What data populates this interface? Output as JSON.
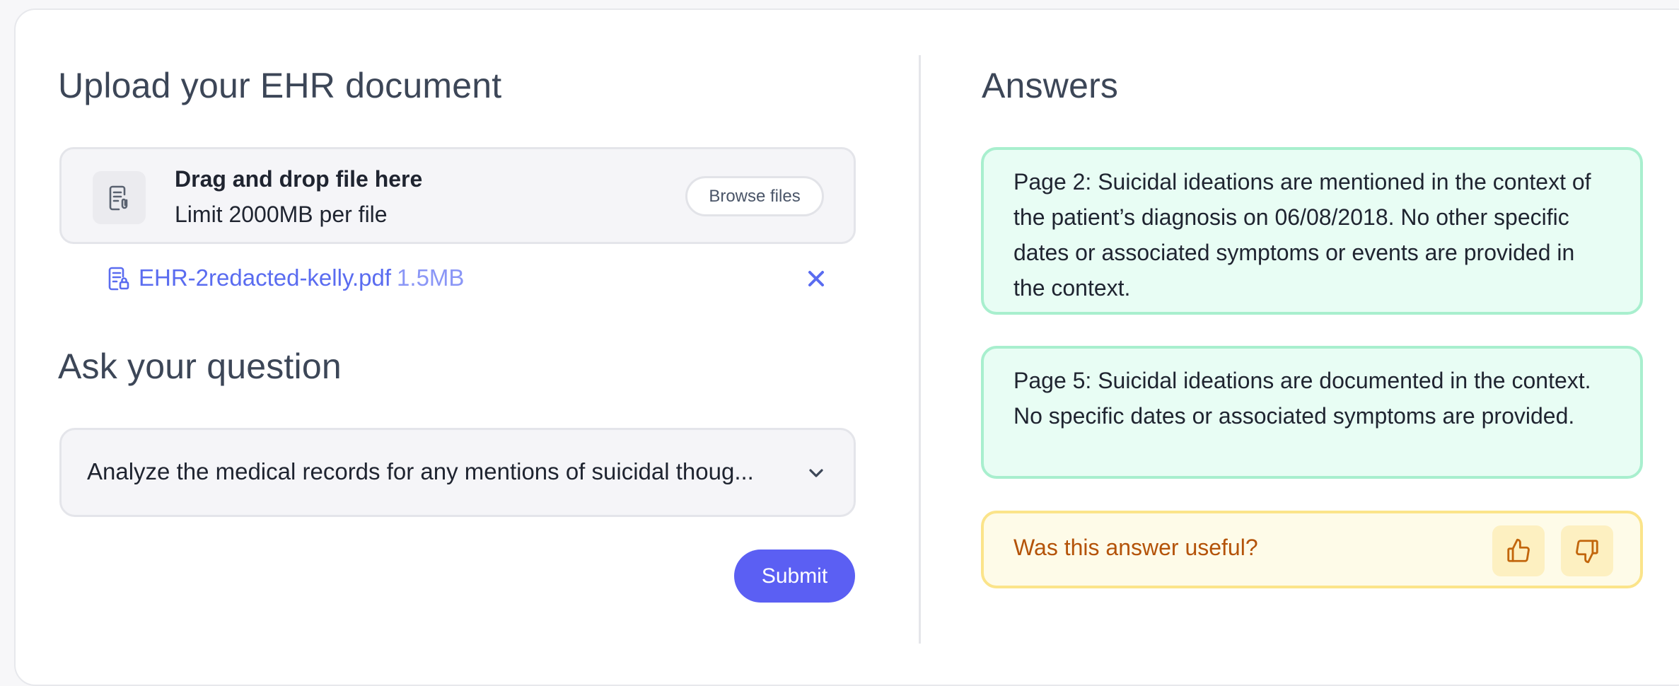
{
  "upload": {
    "heading": "Upload your EHR document",
    "dropzone_title": "Drag and drop file here",
    "dropzone_limit": "Limit 2000MB per file",
    "browse_label": "Browse files",
    "file_name": "EHR-2redacted-kelly.pdf",
    "file_size": "1.5MB"
  },
  "question": {
    "heading": "Ask your question",
    "selected": "Analyze the medical records for any mentions of suicidal thoug...",
    "submit_label": "Submit"
  },
  "answers": {
    "heading": "Answers",
    "items": [
      "Page 2: Suicidal ideations are mentioned in the context of the patient’s diagnosis on 06/08/2018. No other specific dates or associated symptoms or events are provided in the context.",
      "Page 5: Suicidal ideations are documented in the context. No specific dates or associated symptoms are provided."
    ],
    "feedback_prompt": "Was this answer useful?"
  },
  "icons": {
    "dropzone": "document-upload-icon",
    "file": "pdf-file-icon",
    "remove": "close-icon",
    "select": "chevron-down-icon",
    "like": "thumbs-up-icon",
    "dislike": "thumbs-down-icon"
  },
  "colors": {
    "accent": "#5b5ff3",
    "answer_bg": "#e8fdf4",
    "answer_border": "#a8efce",
    "feedback_bg": "#fefbe8",
    "feedback_border": "#fbe48a",
    "feedback_text": "#b45309"
  }
}
